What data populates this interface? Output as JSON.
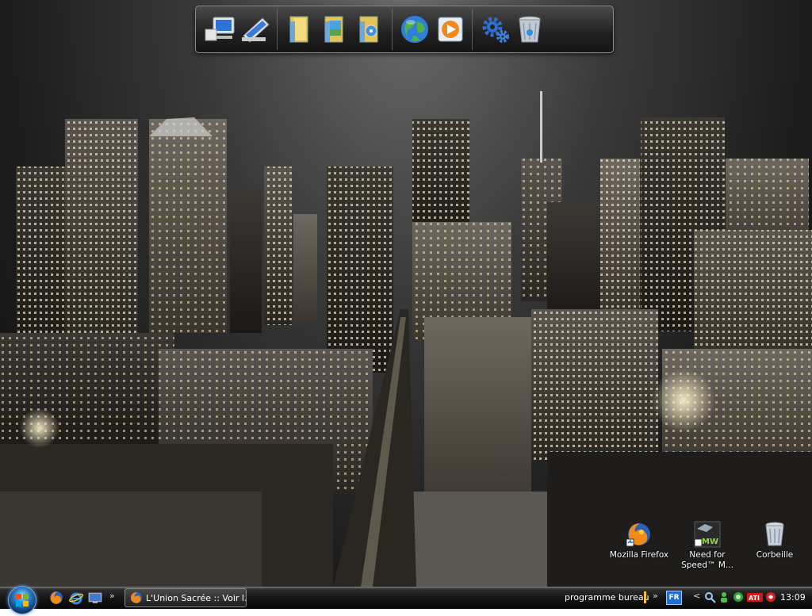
{
  "dock": {
    "items": [
      {
        "icon": "computer-icon"
      },
      {
        "icon": "documents-icon"
      },
      {
        "icon": "folder-icon"
      },
      {
        "icon": "pictures-folder-icon"
      },
      {
        "icon": "music-folder-icon"
      },
      {
        "icon": "internet-globe-icon"
      },
      {
        "icon": "media-player-icon"
      },
      {
        "icon": "settings-gears-icon"
      },
      {
        "icon": "recycle-bin-icon"
      }
    ]
  },
  "desktop_icons": [
    {
      "label": "Mozilla Firefox",
      "icon": "firefox-icon"
    },
    {
      "label": "Need for Speed™ M...",
      "label_line1": "Need for",
      "label_line2": "Speed™ M...",
      "icon_text": "MW",
      "icon": "nfs-most-wanted-icon"
    },
    {
      "label": "Corbeille",
      "icon": "recycle-bin-icon"
    }
  ],
  "taskbar": {
    "quick_launch": [
      {
        "icon": "firefox-icon"
      },
      {
        "icon": "internet-explorer-icon"
      },
      {
        "icon": "show-desktop-icon"
      }
    ],
    "chevron": "»",
    "task_button_label": "L'Union Sacrée :: Voir l...",
    "toolbar_label": "programme bureau",
    "toolbar_chevron": "»",
    "language": "FR",
    "tray_chevron": "<",
    "tray_icons": [
      "search-icon",
      "network-user-icon",
      "messenger-icon",
      "ati-icon",
      "antivirus-icon"
    ],
    "ati_text": "ATI",
    "clock": "13:09"
  },
  "colors": {
    "accent_blue": "#1e6fd1",
    "toolbar_marker": "#f4c430"
  }
}
